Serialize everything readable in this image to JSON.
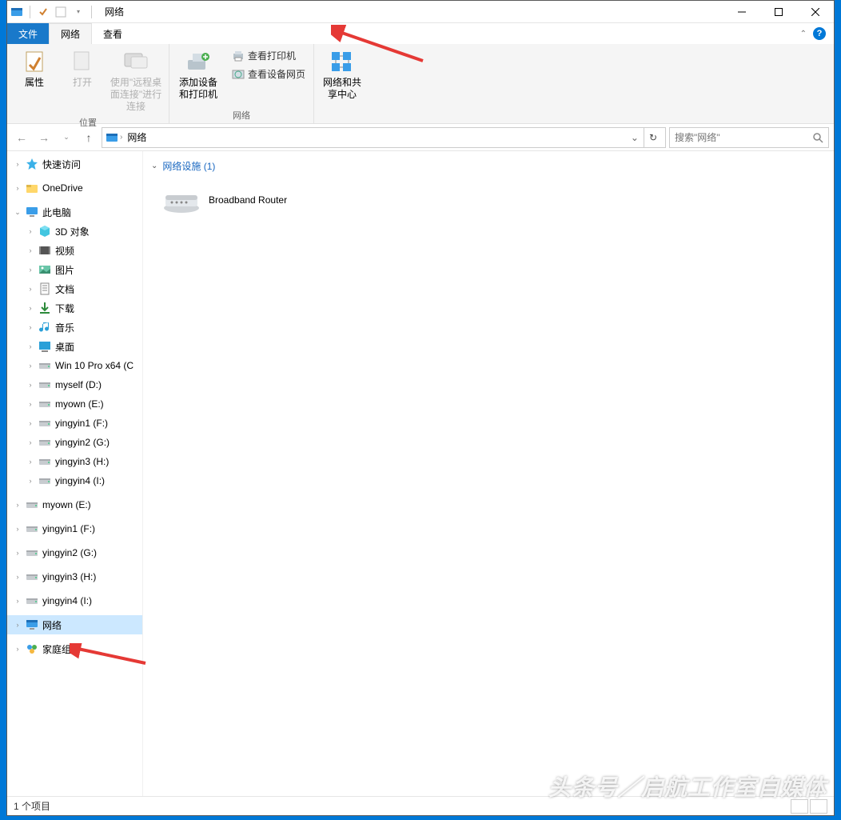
{
  "window": {
    "title": "网络",
    "controls": {
      "min": "minimize",
      "max": "maximize",
      "close": "close"
    }
  },
  "ribbon": {
    "tabs": {
      "file": "文件",
      "network": "网络",
      "view": "查看"
    },
    "groups": {
      "location": {
        "label": "位置",
        "properties": "属性",
        "open": "打开",
        "rdp": "使用\"远程桌面连接\"进行连接"
      },
      "network": {
        "label": "网络",
        "add_device": "添加设备和打印机",
        "view_printers": "查看打印机",
        "view_device_page": "查看设备网页"
      },
      "sharing_center": {
        "label": "网络和共享中心"
      }
    }
  },
  "nav": {
    "crumb": "网络",
    "search_placeholder": "搜索\"网络\""
  },
  "sidebar": [
    {
      "label": "快速访问",
      "indent": 0,
      "icon": "star",
      "toggle": ">"
    },
    {
      "label": "OneDrive",
      "indent": 0,
      "icon": "onedrive",
      "toggle": ">"
    },
    {
      "label": "此电脑",
      "indent": 0,
      "icon": "pc",
      "toggle": "v"
    },
    {
      "label": "3D 对象",
      "indent": 1,
      "icon": "cube",
      "toggle": ">"
    },
    {
      "label": "视频",
      "indent": 1,
      "icon": "video",
      "toggle": ">"
    },
    {
      "label": "图片",
      "indent": 1,
      "icon": "pictures",
      "toggle": ">"
    },
    {
      "label": "文档",
      "indent": 1,
      "icon": "docs",
      "toggle": ">"
    },
    {
      "label": "下载",
      "indent": 1,
      "icon": "download",
      "toggle": ">"
    },
    {
      "label": "音乐",
      "indent": 1,
      "icon": "music",
      "toggle": ">"
    },
    {
      "label": "桌面",
      "indent": 1,
      "icon": "desktop",
      "toggle": ">"
    },
    {
      "label": "Win 10 Pro x64 (C",
      "indent": 1,
      "icon": "drive",
      "toggle": ">"
    },
    {
      "label": "myself (D:)",
      "indent": 1,
      "icon": "drive",
      "toggle": ">"
    },
    {
      "label": "myown (E:)",
      "indent": 1,
      "icon": "drive",
      "toggle": ">"
    },
    {
      "label": "yingyin1 (F:)",
      "indent": 1,
      "icon": "drive",
      "toggle": ">"
    },
    {
      "label": "yingyin2 (G:)",
      "indent": 1,
      "icon": "drive",
      "toggle": ">"
    },
    {
      "label": "yingyin3 (H:)",
      "indent": 1,
      "icon": "drive",
      "toggle": ">"
    },
    {
      "label": "yingyin4 (I:)",
      "indent": 1,
      "icon": "drive",
      "toggle": ">"
    },
    {
      "label": "myown (E:)",
      "indent": 0,
      "icon": "drive",
      "toggle": ">"
    },
    {
      "label": "yingyin1 (F:)",
      "indent": 0,
      "icon": "drive",
      "toggle": ">"
    },
    {
      "label": "yingyin2 (G:)",
      "indent": 0,
      "icon": "drive",
      "toggle": ">"
    },
    {
      "label": "yingyin3 (H:)",
      "indent": 0,
      "icon": "drive",
      "toggle": ">"
    },
    {
      "label": "yingyin4 (I:)",
      "indent": 0,
      "icon": "drive",
      "toggle": ">"
    },
    {
      "label": "网络",
      "indent": 0,
      "icon": "network",
      "toggle": ">",
      "selected": true
    },
    {
      "label": "家庭组",
      "indent": 0,
      "icon": "homegroup",
      "toggle": ">"
    }
  ],
  "content": {
    "group_label": "网络设施 (1)",
    "items": [
      {
        "label": "Broadband Router",
        "icon": "router"
      }
    ]
  },
  "statusbar": {
    "text": "1 个项目"
  },
  "watermark": "头条号／启航工作室自媒体"
}
